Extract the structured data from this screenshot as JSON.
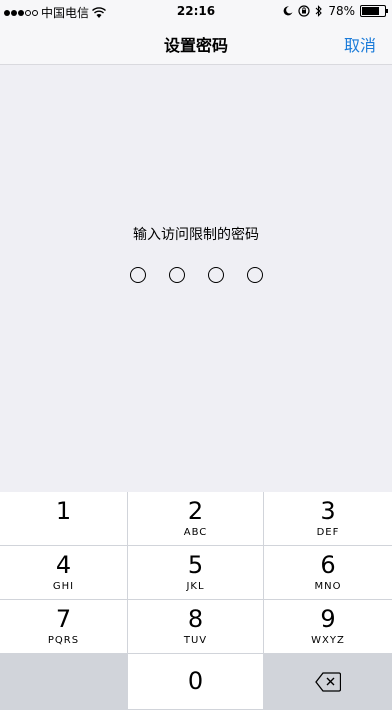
{
  "status_bar": {
    "carrier": "中国电信",
    "time": "22:16",
    "battery": "78%",
    "battery_level": 0.78,
    "icons": [
      "signal-icon",
      "wifi-icon",
      "moon-icon",
      "orientation-lock-icon",
      "bluetooth-icon",
      "battery-icon"
    ]
  },
  "nav": {
    "title": "设置密码",
    "cancel": "取消"
  },
  "prompt": "输入访问限制的密码",
  "pin": {
    "length": 4,
    "filled": 0
  },
  "keypad": {
    "keys": [
      {
        "num": "1",
        "letters": ""
      },
      {
        "num": "2",
        "letters": "ABC"
      },
      {
        "num": "3",
        "letters": "DEF"
      },
      {
        "num": "4",
        "letters": "GHI"
      },
      {
        "num": "5",
        "letters": "JKL"
      },
      {
        "num": "6",
        "letters": "MNO"
      },
      {
        "num": "7",
        "letters": "PQRS"
      },
      {
        "num": "8",
        "letters": "TUV"
      },
      {
        "num": "9",
        "letters": "WXYZ"
      },
      {
        "num": "0",
        "letters": ""
      }
    ]
  }
}
